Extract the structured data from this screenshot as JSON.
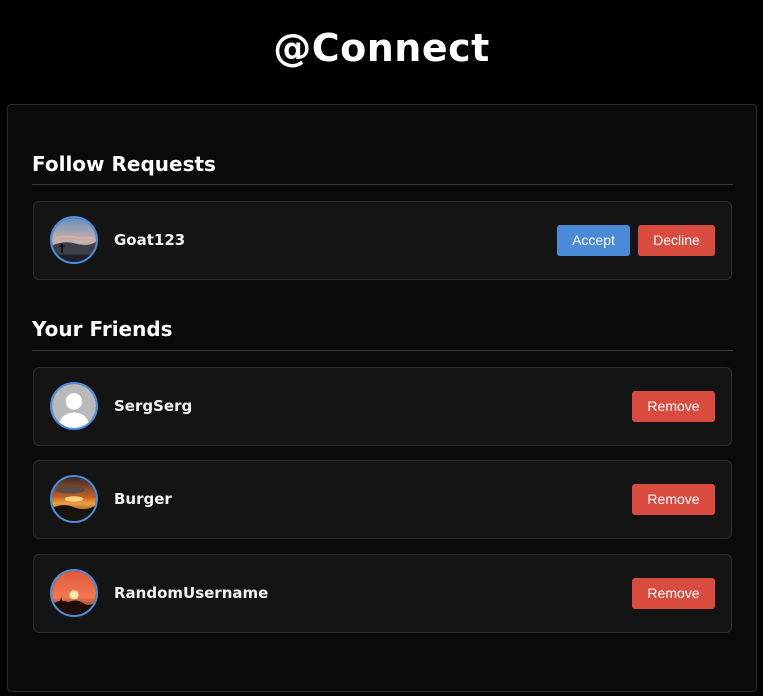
{
  "app": {
    "title": "@Connect"
  },
  "follow_requests": {
    "heading": "Follow Requests",
    "items": [
      {
        "username": "Goat123",
        "avatar": "sky-landscape-photo",
        "accept_label": "Accept",
        "decline_label": "Decline"
      }
    ]
  },
  "friends": {
    "heading": "Your Friends",
    "items": [
      {
        "username": "SergSerg",
        "avatar": "default-person-avatar",
        "remove_label": "Remove"
      },
      {
        "username": "Burger",
        "avatar": "sunset-clouds-photo",
        "remove_label": "Remove"
      },
      {
        "username": "RandomUsername",
        "avatar": "sunset-sun-photo",
        "remove_label": "Remove"
      }
    ]
  },
  "colors": {
    "background": "#000000",
    "accent_blue": "#4a8ad8",
    "danger_red": "#d94b3f",
    "avatar_ring": "#4a8fe0"
  }
}
